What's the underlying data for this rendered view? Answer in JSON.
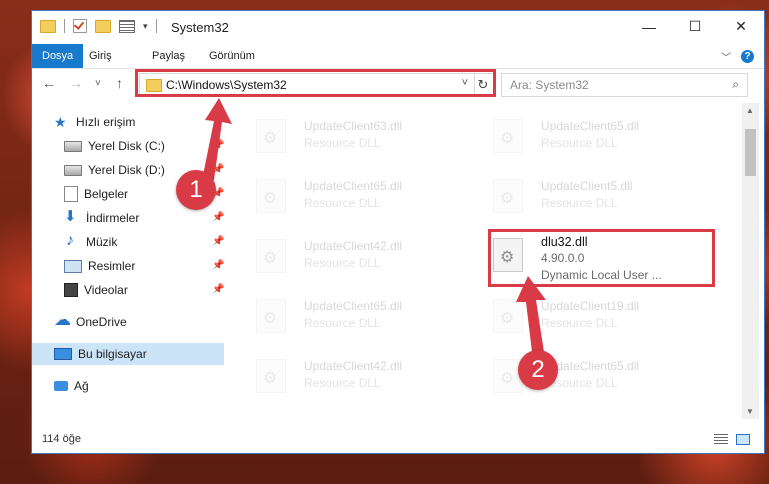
{
  "window": {
    "title": "System32",
    "minimize_glyph": "—",
    "maximize_glyph": "☐",
    "close_glyph": "✕"
  },
  "ribbon": {
    "tabs": [
      {
        "label": "Dosya",
        "active": true
      },
      {
        "label": "Giriş"
      },
      {
        "label": "Paylaş"
      },
      {
        "label": "Görünüm"
      }
    ],
    "expand_glyph": "﹀",
    "help_glyph": "?"
  },
  "nav": {
    "back_glyph": "←",
    "forward_glyph": "→",
    "recent_glyph": "˅",
    "up_glyph": "↑",
    "address": "C:\\Windows\\System32",
    "address_dropdown_glyph": "˅",
    "refresh_glyph": "↻",
    "search_placeholder": "Ara: System32",
    "search_glyph": "⌕"
  },
  "sidebar": {
    "items": [
      {
        "label": "Hızlı erişim",
        "icon": "star-icon"
      },
      {
        "label": "Yerel Disk (C:)",
        "icon": "disk-icon",
        "pinned": true
      },
      {
        "label": "Yerel Disk (D:)",
        "icon": "disk-icon",
        "pinned": true
      },
      {
        "label": "Belgeler",
        "icon": "documents-icon",
        "pinned": true
      },
      {
        "label": "İndirmeler",
        "icon": "download-icon",
        "pinned": true
      },
      {
        "label": "Müzik",
        "icon": "music-icon",
        "pinned": true
      },
      {
        "label": "Resimler",
        "icon": "pictures-icon",
        "pinned": true
      },
      {
        "label": "Videolar",
        "icon": "videos-icon",
        "pinned": true
      },
      {
        "label": "OneDrive",
        "icon": "onedrive-icon"
      },
      {
        "label": "Bu bilgisayar",
        "icon": "this-pc-icon",
        "selected": true
      },
      {
        "label": "Ağ",
        "icon": "network-icon"
      }
    ],
    "pin_glyph": "📌"
  },
  "files": [
    {
      "name": "UpdateClient63.dll",
      "sub": "Resource DLL",
      "faded": true
    },
    {
      "name": "UpdateClient65.dll",
      "sub": "Resource DLL",
      "faded": true
    },
    {
      "name": "UpdateClient65.dll",
      "sub": "Resource DLL",
      "faded": true
    },
    {
      "name": "UpdateClient5.dll",
      "sub": "Resource DLL",
      "faded": true
    },
    {
      "name": "UpdateClient42.dll",
      "sub": "Resource DLL",
      "faded": true
    },
    {
      "name": "dlu32.dll",
      "sub": "4.90.0.0",
      "sub2": "Dynamic Local User ...",
      "faded": false
    },
    {
      "name": "UpdateClient65.dll",
      "sub": "Resource DLL",
      "faded": true
    },
    {
      "name": "UpdateClient19.dll",
      "sub": "Resource DLL",
      "faded": true
    },
    {
      "name": "UpdateClient42.dll",
      "sub": "Resource DLL",
      "faded": true
    },
    {
      "name": "UpdateClient65.dll",
      "sub": "Resource DLL",
      "faded": true
    }
  ],
  "status": {
    "count": "114 öğe"
  },
  "annotations": {
    "step1": "1",
    "step2": "2",
    "color": "#d83b45"
  }
}
